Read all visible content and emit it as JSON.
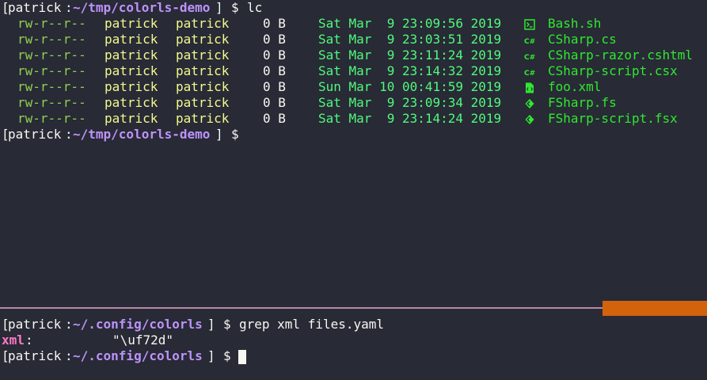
{
  "top_pane": {
    "prompt": {
      "open": "[",
      "user": "patrick",
      "colon": ":",
      "path": "~/tmp/colorls-demo",
      "close": "]",
      "dollar": "$"
    },
    "command": "lc",
    "files": [
      {
        "perm": "rw-r--r--",
        "owner": "patrick",
        "group": "patrick",
        "size": "0 B",
        "date": "Sat Mar  9 23:09:56 2019",
        "icon": "terminal-file-icon",
        "name": "Bash.sh"
      },
      {
        "perm": "rw-r--r--",
        "owner": "patrick",
        "group": "patrick",
        "size": "0 B",
        "date": "Sat Mar  9 23:03:51 2019",
        "icon": "csharp-file-icon",
        "name": "CSharp.cs"
      },
      {
        "perm": "rw-r--r--",
        "owner": "patrick",
        "group": "patrick",
        "size": "0 B",
        "date": "Sat Mar  9 23:11:24 2019",
        "icon": "csharp-file-icon",
        "name": "CSharp-razor.cshtml"
      },
      {
        "perm": "rw-r--r--",
        "owner": "patrick",
        "group": "patrick",
        "size": "0 B",
        "date": "Sat Mar  9 23:14:32 2019",
        "icon": "csharp-file-icon",
        "name": "CSharp-script.csx"
      },
      {
        "perm": "rw-r--r--",
        "owner": "patrick",
        "group": "patrick",
        "size": "0 B",
        "date": "Sun Mar 10 00:41:59 2019",
        "icon": "code-file-icon",
        "name": "foo.xml"
      },
      {
        "perm": "rw-r--r--",
        "owner": "patrick",
        "group": "patrick",
        "size": "0 B",
        "date": "Sat Mar  9 23:09:34 2019",
        "icon": "fsharp-file-icon",
        "name": "FSharp.fs"
      },
      {
        "perm": "rw-r--r--",
        "owner": "patrick",
        "group": "patrick",
        "size": "0 B",
        "date": "Sat Mar  9 23:14:24 2019",
        "icon": "fsharp-file-icon",
        "name": "FSharp-script.fsx"
      }
    ],
    "prompt2": {
      "open": "[",
      "user": "patrick",
      "colon": ":",
      "path": "~/tmp/colorls-demo",
      "close": "]",
      "dollar": "$"
    }
  },
  "bottom_pane": {
    "prompt": {
      "open": "[",
      "user": "patrick",
      "colon": ":",
      "path": "~/.config/colorls",
      "close": "]",
      "dollar": "$"
    },
    "command": "grep xml files.yaml",
    "output_key": "xml",
    "output_colon": ":",
    "output_value": "\"\\uf72d\"",
    "prompt2": {
      "open": "[",
      "user": "patrick",
      "colon": ":",
      "path": "~/.config/colorls",
      "close": "]",
      "dollar": "$"
    }
  },
  "colors": {
    "background": "#282a36",
    "pane_divider": "#b788a8",
    "scroll_indicator": "#d3620c",
    "file_name": "#2fe82f",
    "date": "#50fa7b",
    "permissions": "#8fd14f",
    "owner": "#f1fa8c",
    "path": "#bd93f9"
  }
}
